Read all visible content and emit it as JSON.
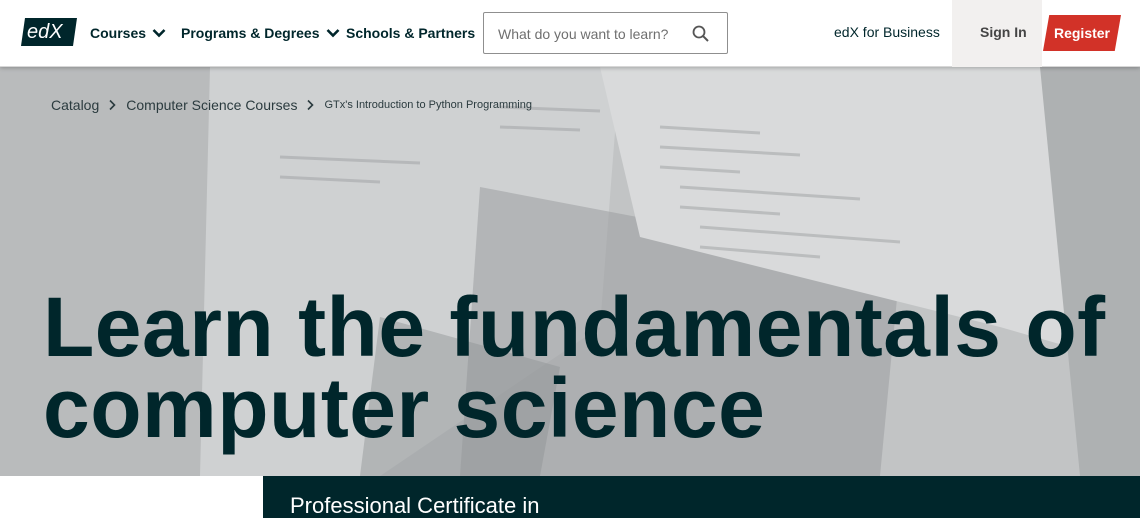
{
  "header": {
    "logo_text": "edX",
    "nav": {
      "courses": "Courses",
      "programs": "Programs & Degrees",
      "schools": "Schools & Partners"
    },
    "search": {
      "placeholder": "What do you want to learn?",
      "value": ""
    },
    "business_link": "edX for Business",
    "sign_in": "Sign In",
    "register": "Register"
  },
  "breadcrumb": {
    "items": [
      "Catalog",
      "Computer Science Courses",
      "GTx's Introduction to Python Programming"
    ]
  },
  "hero": {
    "headline_line1": "Learn the fundamentals of",
    "headline_line2": "computer science"
  },
  "card": {
    "text": "Professional Certificate in"
  },
  "colors": {
    "brand_dark": "#00262b",
    "register_red": "#d23228",
    "hero_gray": "#c3c5c6"
  },
  "icons": [
    "chevron-down-icon",
    "search-icon",
    "chevron-right-icon"
  ]
}
